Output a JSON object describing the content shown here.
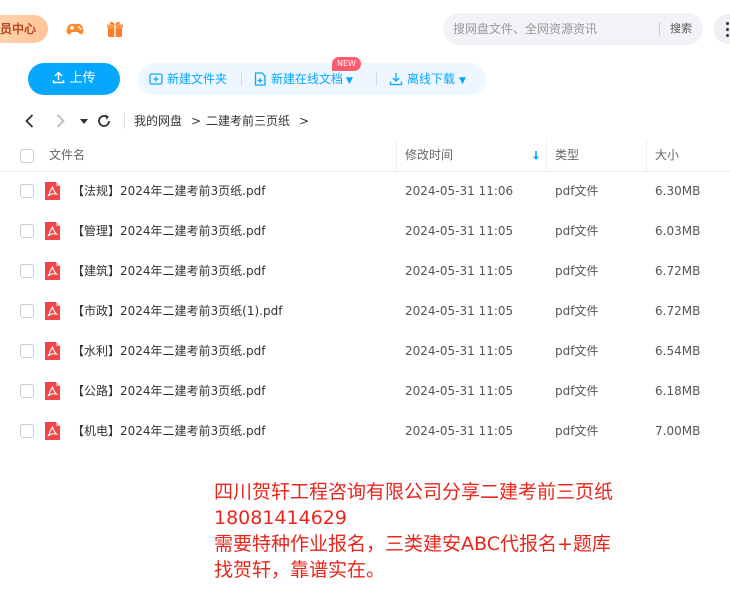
{
  "header": {
    "vip_label": "员中心",
    "search_placeholder": "搜网盘文件、全网资源资讯",
    "search_button": "搜索"
  },
  "toolbar": {
    "upload_label": "上传",
    "new_folder_label": "新建文件夹",
    "new_online_doc_label": "新建在线文档",
    "new_badge": "NEW",
    "offline_download_label": "离线下载"
  },
  "breadcrumb": {
    "root": "我的网盘",
    "current": "二建考前三页纸",
    "separator": ">"
  },
  "table": {
    "columns": {
      "name": "文件名",
      "modified": "修改时间",
      "type": "类型",
      "size": "大小"
    },
    "rows": [
      {
        "name": "【法规】2024年二建考前3页纸.pdf",
        "modified": "2024-05-31 11:06",
        "type": "pdf文件",
        "size": "6.30MB"
      },
      {
        "name": "【管理】2024年二建考前3页纸.pdf",
        "modified": "2024-05-31 11:05",
        "type": "pdf文件",
        "size": "6.03MB"
      },
      {
        "name": "【建筑】2024年二建考前3页纸.pdf",
        "modified": "2024-05-31 11:05",
        "type": "pdf文件",
        "size": "6.72MB"
      },
      {
        "name": "【市政】2024年二建考前3页纸(1).pdf",
        "modified": "2024-05-31 11:05",
        "type": "pdf文件",
        "size": "6.72MB"
      },
      {
        "name": "【水利】2024年二建考前3页纸.pdf",
        "modified": "2024-05-31 11:05",
        "type": "pdf文件",
        "size": "6.54MB"
      },
      {
        "name": "【公路】2024年二建考前3页纸.pdf",
        "modified": "2024-05-31 11:05",
        "type": "pdf文件",
        "size": "6.18MB"
      },
      {
        "name": "【机电】2024年二建考前3页纸.pdf",
        "modified": "2024-05-31 11:05",
        "type": "pdf文件",
        "size": "7.00MB"
      }
    ]
  },
  "overlay": {
    "line1": "四川贺轩工程咨询有限公司分享二建考前三页纸",
    "line2": "18081414629",
    "line3": "需要特种作业报名，三类建安ABC代报名+题库",
    "line4": "找贺轩，靠谱实在。"
  },
  "colors": {
    "accent": "#06a7ff",
    "pdf_red": "#f0464a",
    "overlay_red": "#e8261c"
  }
}
